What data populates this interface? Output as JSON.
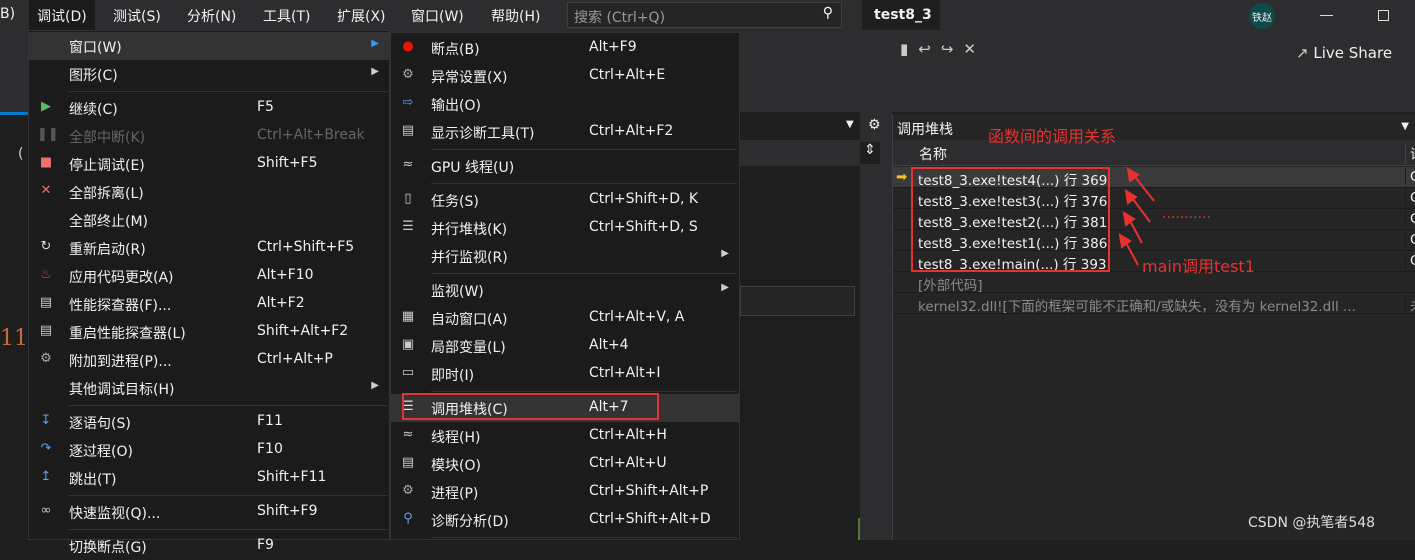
{
  "menubar": {
    "items": [
      "B)",
      "调试(D)",
      "测试(S)",
      "分析(N)",
      "工具(T)",
      "扩展(X)",
      "窗口(W)",
      "帮助(H)"
    ],
    "search_placeholder": "搜索 (Ctrl+Q)",
    "title": "test8_3",
    "user": "铁赵",
    "live_share": "Live Share"
  },
  "debug_menu": {
    "items": [
      {
        "label": "窗口(W)",
        "shortcut": "",
        "icon": "",
        "submenu": true,
        "highlight": true
      },
      {
        "label": "图形(C)",
        "shortcut": "",
        "icon": "",
        "submenu": true
      },
      {
        "sep": true
      },
      {
        "label": "继续(C)",
        "shortcut": "F5",
        "icon": "play-icon"
      },
      {
        "label": "全部中断(K)",
        "shortcut": "Ctrl+Alt+Break",
        "icon": "pause-icon",
        "disabled": true
      },
      {
        "label": "停止调试(E)",
        "shortcut": "Shift+F5",
        "icon": "stop-icon"
      },
      {
        "label": "全部拆离(L)",
        "shortcut": "",
        "icon": "close-icon"
      },
      {
        "label": "全部终止(M)",
        "shortcut": "",
        "icon": ""
      },
      {
        "label": "重新启动(R)",
        "shortcut": "Ctrl+Shift+F5",
        "icon": "restart-icon"
      },
      {
        "label": "应用代码更改(A)",
        "shortcut": "Alt+F10",
        "icon": "flame-icon"
      },
      {
        "label": "性能探查器(F)...",
        "shortcut": "Alt+F2",
        "icon": "profiler-icon"
      },
      {
        "label": "重启性能探查器(L)",
        "shortcut": "Shift+Alt+F2",
        "icon": "profiler-icon"
      },
      {
        "label": "附加到进程(P)...",
        "shortcut": "Ctrl+Alt+P",
        "icon": "gears-icon"
      },
      {
        "label": "其他调试目标(H)",
        "shortcut": "",
        "icon": "",
        "submenu": true
      },
      {
        "sep": true
      },
      {
        "label": "逐语句(S)",
        "shortcut": "F11",
        "icon": "step-into-icon"
      },
      {
        "label": "逐过程(O)",
        "shortcut": "F10",
        "icon": "step-over-icon"
      },
      {
        "label": "跳出(T)",
        "shortcut": "Shift+F11",
        "icon": "step-out-icon"
      },
      {
        "sep": true
      },
      {
        "label": "快速监视(Q)...",
        "shortcut": "Shift+F9",
        "icon": "glasses-icon"
      },
      {
        "sep": true
      },
      {
        "label": "切换断点(G)",
        "shortcut": "F9",
        "icon": ""
      }
    ]
  },
  "window_submenu": {
    "items": [
      {
        "label": "断点(B)",
        "shortcut": "Alt+F9",
        "icon": "breakpoint-icon"
      },
      {
        "label": "异常设置(X)",
        "shortcut": "Ctrl+Alt+E",
        "icon": "exception-icon"
      },
      {
        "label": "输出(O)",
        "shortcut": "",
        "icon": "output-icon"
      },
      {
        "label": "显示诊断工具(T)",
        "shortcut": "Ctrl+Alt+F2",
        "icon": "diagnostics-icon"
      },
      {
        "sep": true
      },
      {
        "label": "GPU 线程(U)",
        "shortcut": "",
        "icon": "threads-icon"
      },
      {
        "sep": true
      },
      {
        "label": "任务(S)",
        "shortcut": "Ctrl+Shift+D, K",
        "icon": "clipboard-icon"
      },
      {
        "label": "并行堆栈(K)",
        "shortcut": "Ctrl+Shift+D, S",
        "icon": "parallel-stacks-icon"
      },
      {
        "label": "并行监视(R)",
        "shortcut": "",
        "icon": "",
        "submenu": true
      },
      {
        "sep": true
      },
      {
        "label": "监视(W)",
        "shortcut": "",
        "icon": "",
        "submenu": true
      },
      {
        "label": "自动窗口(A)",
        "shortcut": "Ctrl+Alt+V, A",
        "icon": "autos-icon"
      },
      {
        "label": "局部变量(L)",
        "shortcut": "Alt+4",
        "icon": "locals-icon"
      },
      {
        "label": "即时(I)",
        "shortcut": "Ctrl+Alt+I",
        "icon": "immediate-icon"
      },
      {
        "sep": true
      },
      {
        "label": "调用堆栈(C)",
        "shortcut": "Alt+7",
        "icon": "call-stack-icon",
        "highlight": true
      },
      {
        "label": "线程(H)",
        "shortcut": "Ctrl+Alt+H",
        "icon": "threads-icon"
      },
      {
        "label": "模块(O)",
        "shortcut": "Ctrl+Alt+U",
        "icon": "modules-icon"
      },
      {
        "label": "进程(P)",
        "shortcut": "Ctrl+Shift+Alt+P",
        "icon": "gears-icon"
      },
      {
        "label": "诊断分析(D)",
        "shortcut": "Ctrl+Shift+Alt+D",
        "icon": "diagnostic-analysis-icon"
      },
      {
        "sep": true
      }
    ]
  },
  "call_stack": {
    "title": "调用堆栈",
    "column_name": "名称",
    "column_lang": "语",
    "rows": [
      {
        "name": "test8_3.exe!test4(...) 行 369",
        "lang": "C",
        "current": true
      },
      {
        "name": "test8_3.exe!test3(...) 行 376",
        "lang": "C"
      },
      {
        "name": "test8_3.exe!test2(...) 行 381",
        "lang": "C"
      },
      {
        "name": "test8_3.exe!test1(...) 行 386",
        "lang": "C"
      },
      {
        "name": "test8_3.exe!main(...) 行 393",
        "lang": "C"
      },
      {
        "name": "[外部代码]",
        "lang": "",
        "dim": true
      },
      {
        "name": "kernel32.dll![下面的框架可能不正确和/或缺失，没有为 kernel32.dll ...",
        "lang": "未",
        "dim": true
      }
    ]
  },
  "annotations": {
    "title": "函数间的调用关系",
    "dots": "...........",
    "main_note": "main调用test1",
    "color": "#e8322f"
  },
  "editor": {
    "line_number": "11",
    "tab": "("
  },
  "watermark": "CSDN @执笔者548"
}
